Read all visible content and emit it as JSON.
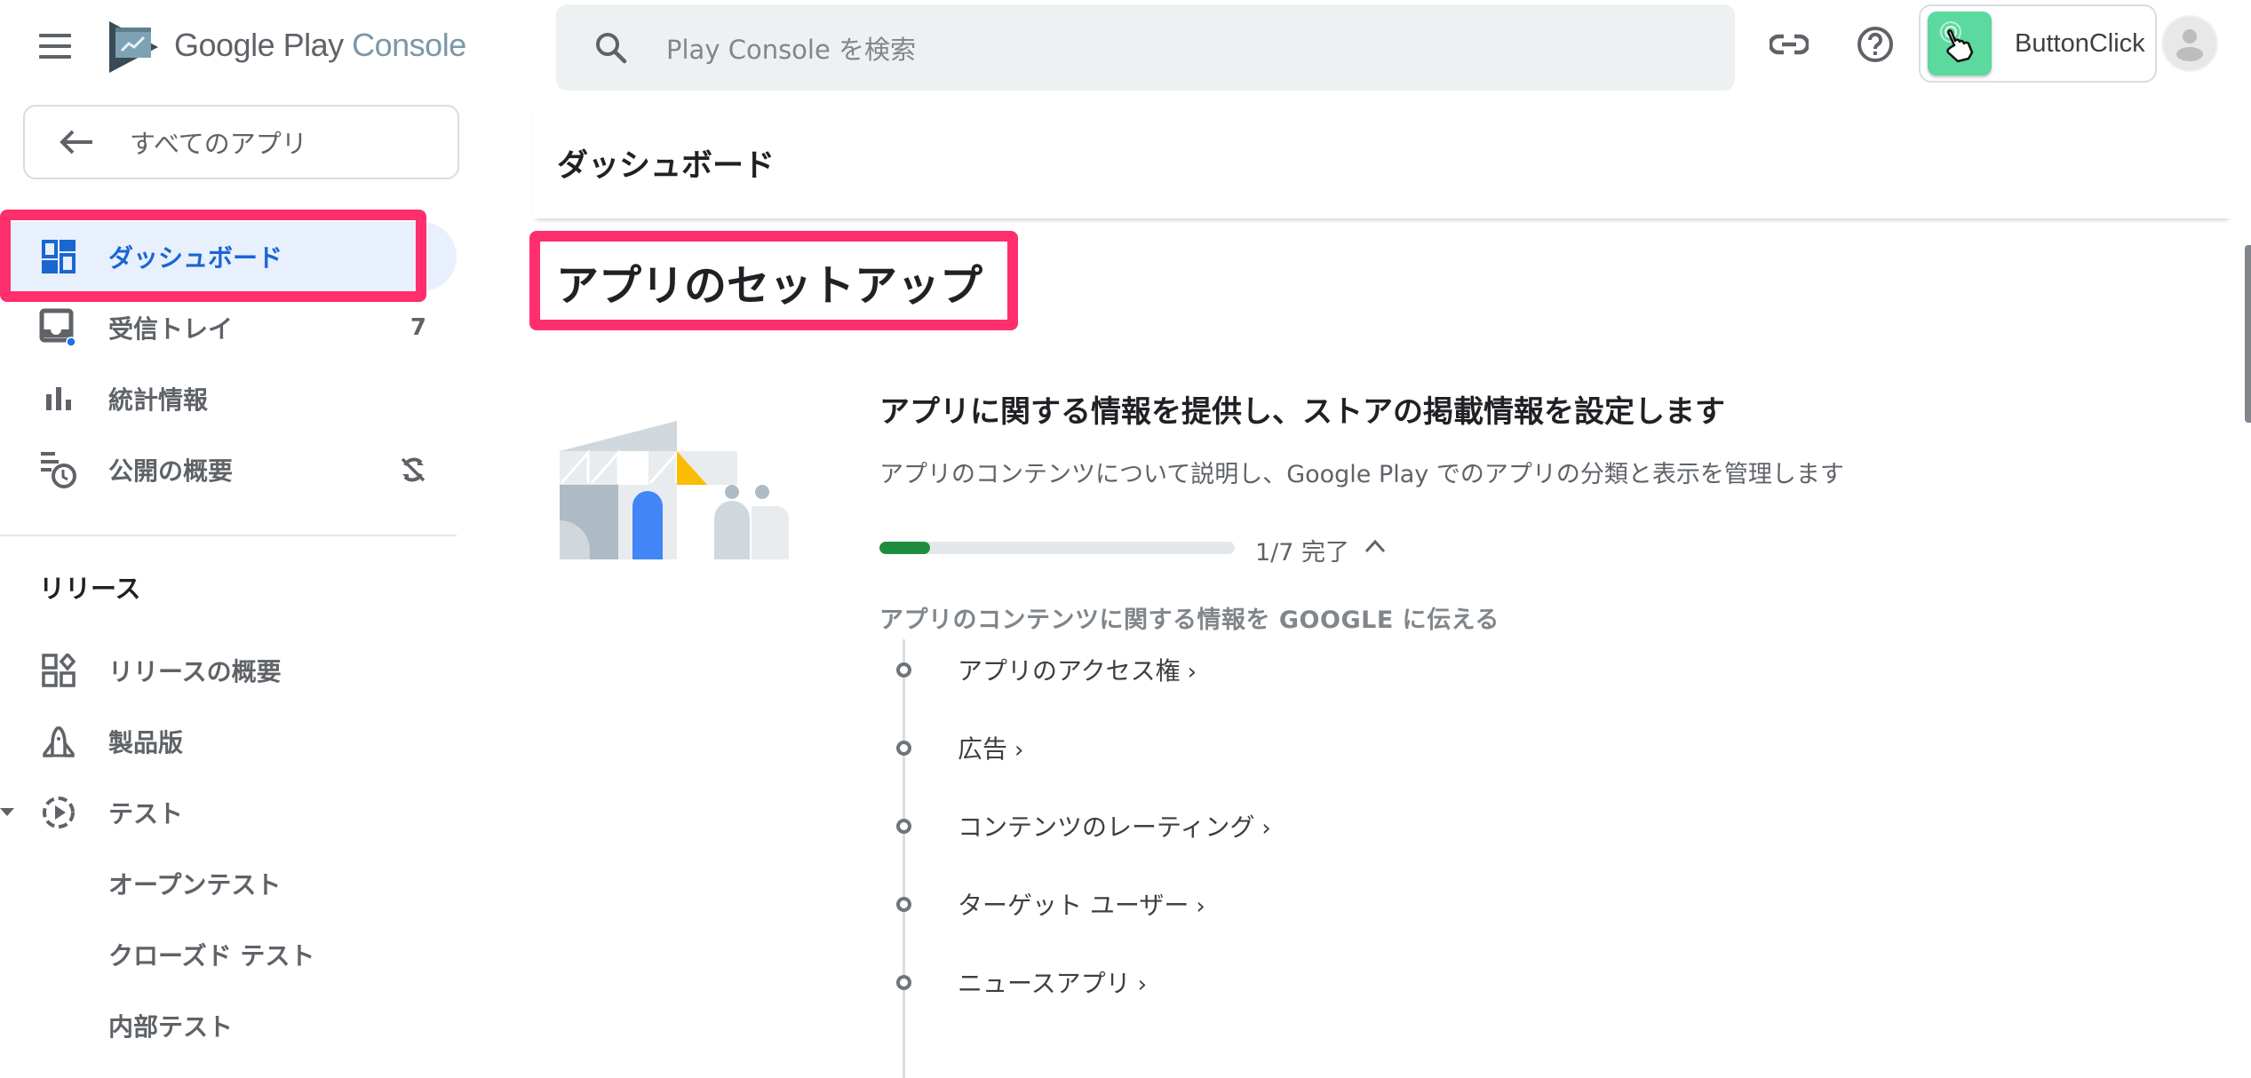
{
  "app": {
    "logo_text_google_play": "Google Play",
    "logo_text_console": "Console"
  },
  "search": {
    "placeholder": "Play Console を検索",
    "icon": "search-icon"
  },
  "header_actions": {
    "link_icon": "link-icon",
    "help_icon": "help-icon",
    "app_name": "ButtonClick",
    "app_icon_color": "#5cd99f"
  },
  "sidebar": {
    "back_label": "すべてのアプリ",
    "items": [
      {
        "label": "ダッシュボード",
        "icon": "dashboard-icon",
        "active": true
      },
      {
        "label": "受信トレイ",
        "icon": "inbox-icon",
        "badge": "7"
      },
      {
        "label": "統計情報",
        "icon": "bar-chart-icon"
      },
      {
        "label": "公開の概要",
        "icon": "publishing-overview-icon",
        "status_icon": "sync-disabled-icon"
      }
    ],
    "release_section": {
      "title": "リリース",
      "items": [
        {
          "label": "リリースの概要",
          "icon": "release-overview-icon"
        },
        {
          "label": "製品版",
          "icon": "production-icon"
        },
        {
          "label": "テスト",
          "icon": "testing-icon",
          "expanded": true
        },
        {
          "label": "オープンテスト"
        },
        {
          "label": "クローズド テスト"
        },
        {
          "label": "内部テスト"
        }
      ]
    }
  },
  "page": {
    "title": "ダッシュボード",
    "section_heading": "アプリのセットアップ",
    "card": {
      "title": "アプリに関する情報を提供し、ストアの掲載情報を設定します",
      "description": "アプリのコンテンツについて説明し、Google Play でのアプリの分類と表示を管理します",
      "progress": {
        "completed": 1,
        "total": 7,
        "fraction": 0.143,
        "label": "1/7 完了"
      },
      "group_label": "アプリのコンテンツに関する情報を GOOGLE に伝える",
      "tasks": [
        {
          "label": "アプリのアクセス権",
          "chevron": "›"
        },
        {
          "label": "広告",
          "chevron": "›"
        },
        {
          "label": "コンテンツのレーティング",
          "chevron": "›"
        },
        {
          "label": "ターゲット ユーザー",
          "chevron": "›"
        },
        {
          "label": "ニュースアプリ",
          "chevron": "›"
        }
      ]
    }
  },
  "colors": {
    "accent_blue": "#1a66d2",
    "active_bg": "#e8f0fe",
    "highlight_pink": "#ff2e6c",
    "progress_green": "#1e8e3e"
  }
}
